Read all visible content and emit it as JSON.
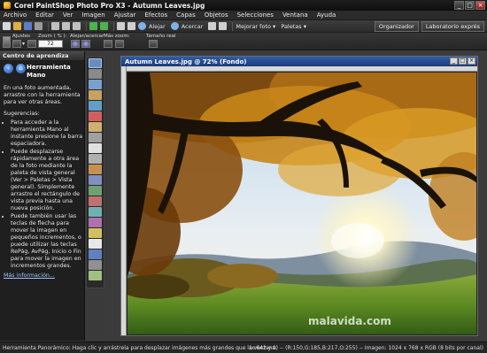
{
  "window": {
    "title": "Corel PaintShop Photo Pro X3 - Autumn Leaves.jpg",
    "controls": [
      "_",
      "□",
      "×"
    ]
  },
  "menu": [
    "Archivo",
    "Editar",
    "Ver",
    "Imagen",
    "Ajustar",
    "Efectos",
    "Capas",
    "Objetos",
    "Selecciones",
    "Ventana",
    "Ayuda"
  ],
  "toolbar": {
    "zoom_out_label": "Alejar",
    "zoom_in_label": "Acercar",
    "improve_photo": "Mejorar foto",
    "palettes": "Paletas",
    "organizer": "Organizador",
    "express_lab": "Laboratorio exprés"
  },
  "tool_options": {
    "presets": "Ajustes",
    "zoom_label": "Zoom ( % ):",
    "zoom_value": "72",
    "zoom_out_in": "Alejar/acercar",
    "more_zoom": "Más zoom:",
    "actual_size": "Tamaño real"
  },
  "learning_center": {
    "header": "Centro de aprendiza",
    "tool_title": "Herramienta Mano",
    "intro": "En una foto aumentada, arrastre con la herramienta para ver otras áreas.",
    "tips_header": "Sugerencias:",
    "tips": [
      "Para acceder a la herramienta Mano al instante presione la barra espaciadora.",
      "Puede desplazarse rápidamente a otra área de la foto mediante la paleta de vista general (Ver > Paletas > Vista general). Simplemente arrastre el rectángulo de vista previa hasta una nueva posición.",
      "Puede también usar las teclas de flecha para mover la imagen en pequeños incrementos, o puede utilizar las teclas RePág, AvPág, Inicio o Fin para mover la imagen en incrementos grandes."
    ],
    "more_info": "Más información..."
  },
  "document": {
    "title": "Autumn Leaves.jpg @  72% (Fondo)",
    "controls": [
      "_",
      "□",
      "×"
    ]
  },
  "watermark": "malavida.com",
  "status": {
    "left": "Herramienta Panorámico: Haga clic y arrástrela para desplazar imágenes más grandes que la ventana.",
    "right": "(x:642 y:0) -- (R:150,G:185,B:217,O:255) -- Imagen:  1024 x 768 x RGB (8 bits por canal)"
  },
  "colors": {
    "doc_title": "#2f5da8",
    "link": "#9cc7ff",
    "tool_selected": "#6b8cc0"
  }
}
